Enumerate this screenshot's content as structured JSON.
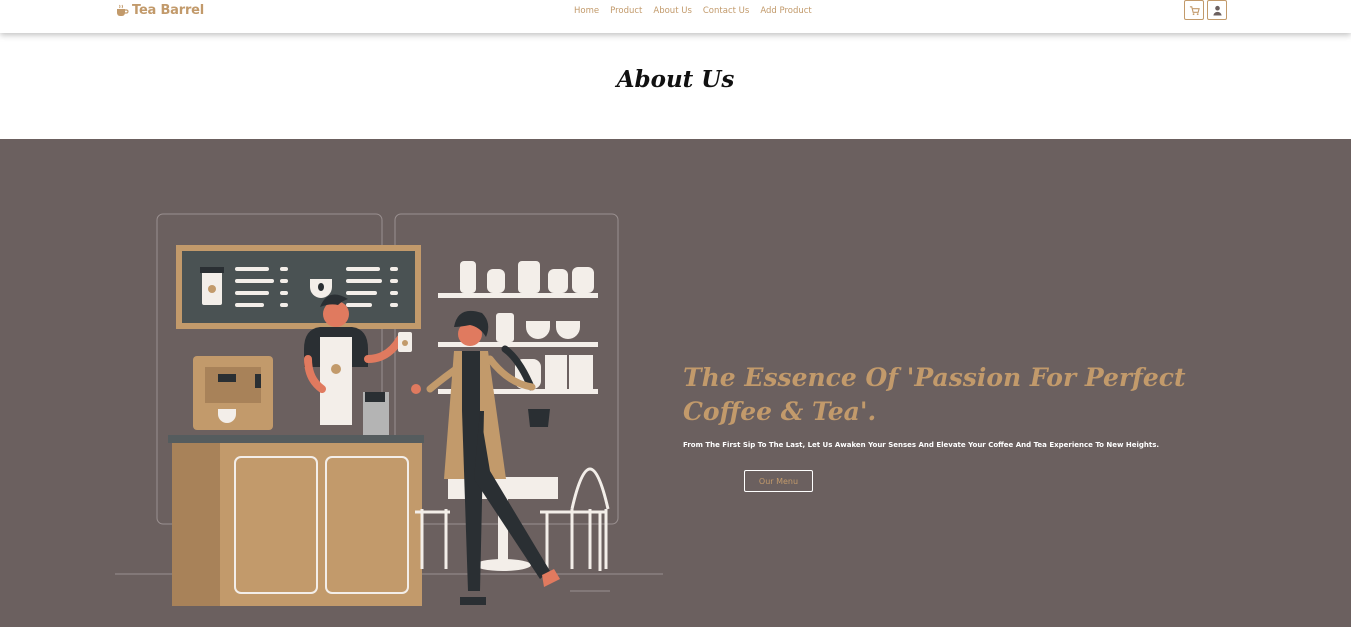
{
  "navbar": {
    "brand": "Tea Barrel",
    "links": [
      "Home",
      "Product",
      "About Us",
      "Contact Us",
      "Add Product"
    ],
    "icons": [
      "cart-icon",
      "user-icon"
    ]
  },
  "page": {
    "title": "About Us"
  },
  "hero": {
    "heading": "The Essence Of 'Passion For Perfect Coffee & Tea'.",
    "subtext": "From The First Sip To The Last, Let Us Awaken Your Senses And Elevate Your Coffee And Tea Experience To New Heights.",
    "button_label": "Our Menu"
  },
  "colors": {
    "accent": "#c29a6b",
    "hero_bg": "#6b605f",
    "dark": "#2a2f33",
    "chalkboard": "#4a5253"
  }
}
